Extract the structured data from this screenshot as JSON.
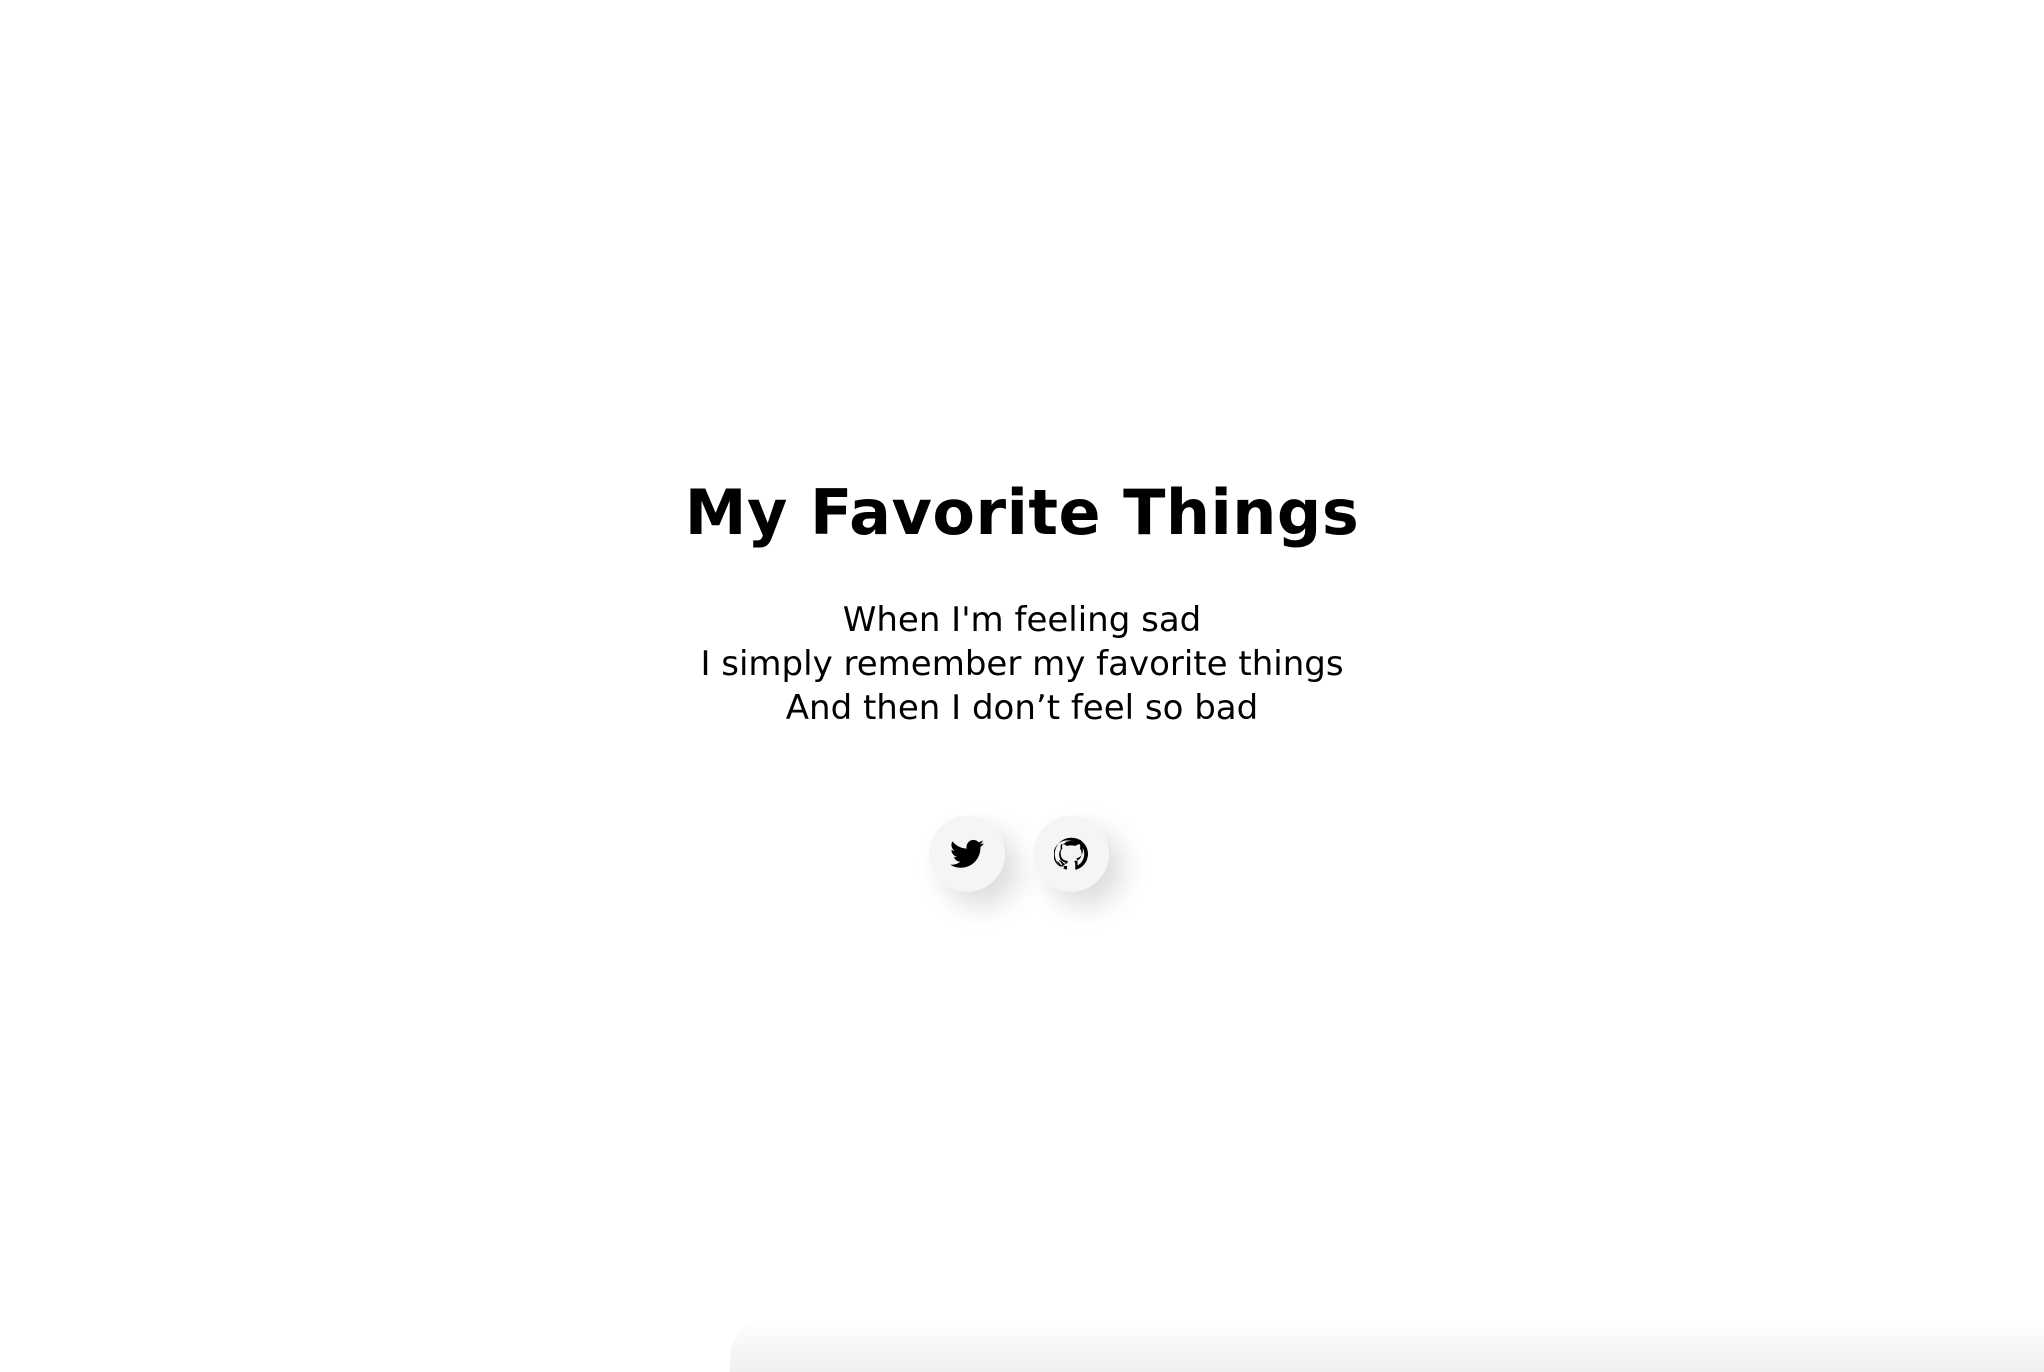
{
  "page": {
    "title": "My Favorite Things",
    "lyrics": [
      "When I'm feeling sad",
      "I simply remember my favorite things",
      "And then I don’t feel so bad"
    ]
  },
  "socials": [
    {
      "icon": "twitter-icon",
      "label": "Twitter"
    },
    {
      "icon": "github-icon",
      "label": "GitHub"
    }
  ],
  "colors": {
    "background": "#ffffff",
    "text": "#000000",
    "button_bg": "#f5f5f5"
  }
}
